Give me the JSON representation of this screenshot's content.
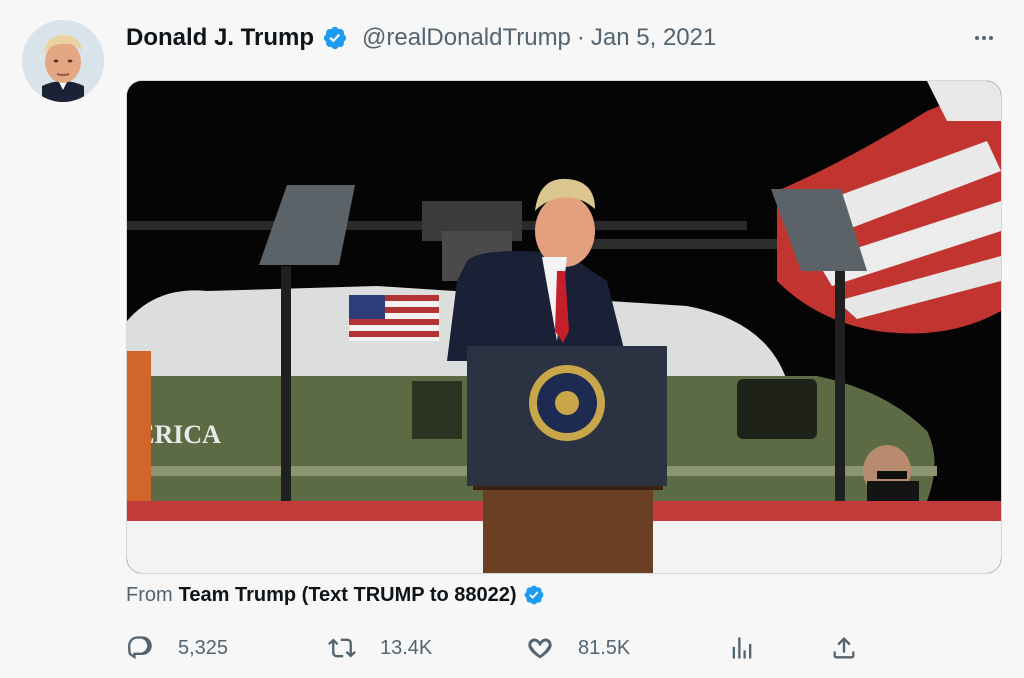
{
  "author": {
    "name": "Donald J. Trump",
    "handle": "@realDonaldTrump",
    "separator": "·",
    "date": "Jan 5, 2021",
    "verified": true
  },
  "media": {
    "helicopter_text": "IERICA",
    "icons": [
      "video-thumbnail"
    ]
  },
  "source": {
    "prefix": "From",
    "name": "Team Trump (Text TRUMP to 88022)",
    "verified": true
  },
  "actions": {
    "replies": "5,325",
    "retweets": "13.4K",
    "likes": "81.5K"
  },
  "colors": {
    "verified": "#1d9bf0",
    "muted": "#536471",
    "text": "#0f1419",
    "background": "#f7f7f7"
  }
}
